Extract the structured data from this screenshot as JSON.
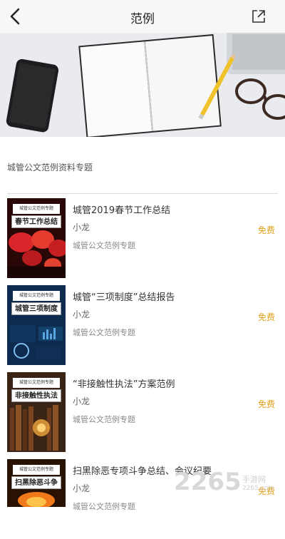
{
  "header": {
    "title": "范例",
    "back_icon": "chevron-left-icon",
    "share_icon": "share-icon"
  },
  "section": {
    "label": "城管公文范例资料专题"
  },
  "items": [
    {
      "title": "城管2019春节工作总结",
      "author": "小龙",
      "category": "城管公文范例专题",
      "price": "免费",
      "cover": {
        "tag": "城管公文范例专题",
        "title": "春节工作总结"
      }
    },
    {
      "title": "城管“三项制度”总结报告",
      "author": "小龙",
      "category": "城管公文范例专题",
      "price": "免费",
      "cover": {
        "tag": "城管公文范例专题",
        "title": "城管三项制度"
      }
    },
    {
      "title": "“非接触性执法”方案范例",
      "author": "小龙",
      "category": "城管公文范例专题",
      "price": "免费",
      "cover": {
        "tag": "城管公文范例专题",
        "title": "非接触性执法"
      }
    },
    {
      "title": "扫黑除恶专项斗争总结、会议纪要",
      "author": "小龙",
      "category": "城管公文范例专题",
      "price": "免费",
      "cover": {
        "tag": "城管公文范例专题",
        "title": "扫黑除恶斗争"
      }
    }
  ],
  "watermark": {
    "main": "2265",
    "sub": "手游网",
    "url": "2265.com"
  },
  "colors": {
    "price": "#e2a019",
    "header_bg": "#f7f7f7"
  }
}
